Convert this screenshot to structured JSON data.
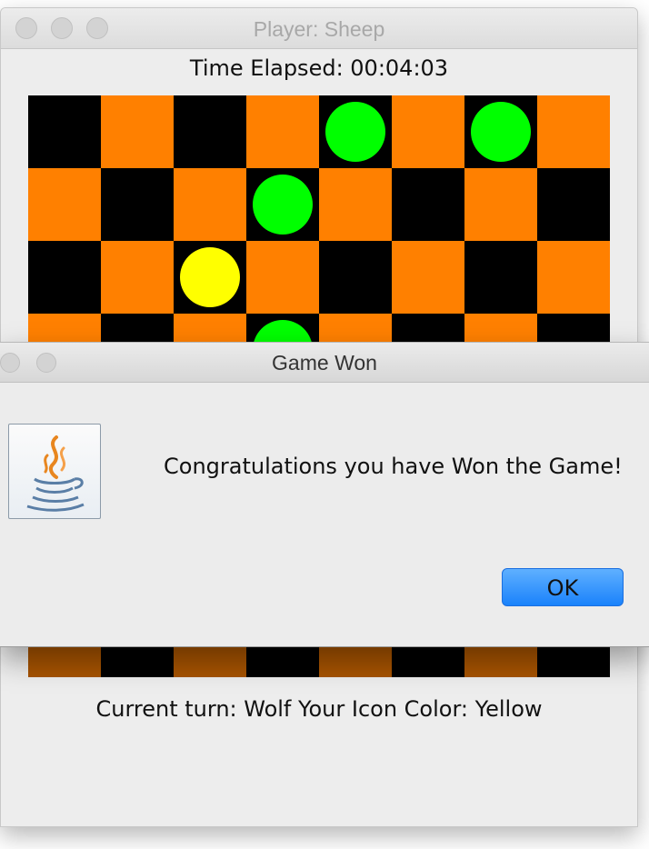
{
  "main_window": {
    "title": "Player: Sheep",
    "timer": "Time Elapsed: 00:04:03",
    "status": "Current turn: Wolf Your Icon Color: Yellow"
  },
  "board": {
    "rows": 8,
    "cols": 8,
    "colors": {
      "dark": "#000000",
      "light": "#ff8000",
      "sheep": "#00ff00",
      "wolf": "#ffff00"
    },
    "pieces": [
      {
        "row": 0,
        "col": 4,
        "type": "sheep"
      },
      {
        "row": 0,
        "col": 6,
        "type": "sheep"
      },
      {
        "row": 1,
        "col": 3,
        "type": "sheep"
      },
      {
        "row": 2,
        "col": 2,
        "type": "wolf"
      },
      {
        "row": 3,
        "col": 3,
        "type": "sheep"
      }
    ]
  },
  "dialog": {
    "title": "Game Won",
    "message": "Congratulations you have Won the Game!",
    "ok_label": "OK",
    "icon": "java-coffee-cup-icon"
  }
}
